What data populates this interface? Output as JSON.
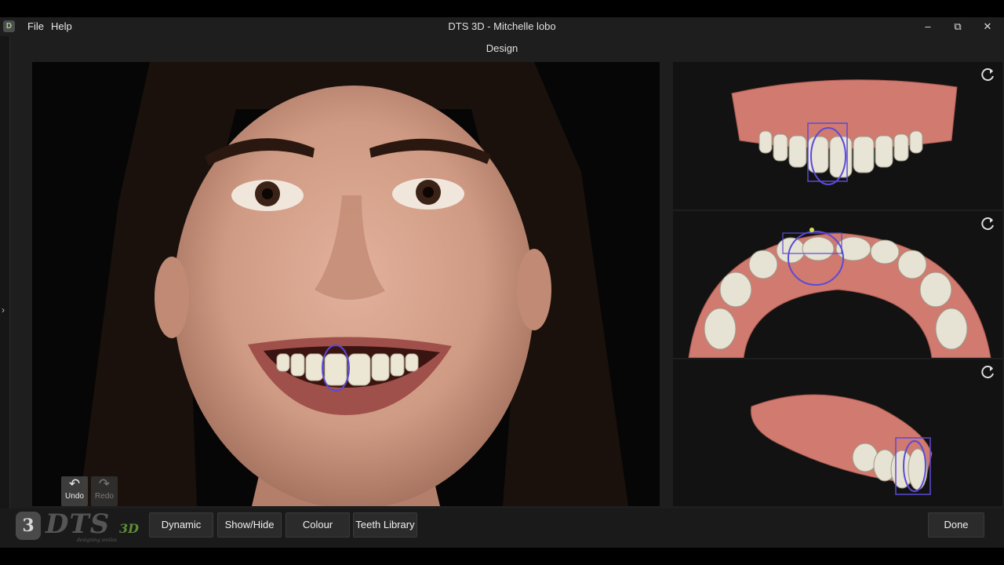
{
  "window": {
    "title": "DTS 3D - Mitchelle lobo",
    "menu": {
      "file": "File",
      "help": "Help"
    },
    "controls": {
      "minimize": "–",
      "maximize": "⧉",
      "close": "✕"
    }
  },
  "page": {
    "subtitle": "Design"
  },
  "photo_tools": {
    "undo_label": "Undo",
    "redo_label": "Redo",
    "undo_icon": "↶",
    "redo_icon": "↷"
  },
  "views": [
    {
      "name": "frontal-3d-view",
      "icon": "reset-view-icon"
    },
    {
      "name": "occlusal-3d-view",
      "icon": "reset-view-icon"
    },
    {
      "name": "lateral-3d-view",
      "icon": "reset-view-icon"
    }
  ],
  "toolbar": {
    "dynamic_label": "Dynamic",
    "showhide_label": "Show/Hide",
    "colour_label": "Colour",
    "library_label": "Teeth Library",
    "done_label": "Done"
  },
  "logo": {
    "mark": "3",
    "text": "DTS",
    "suffix": "3D",
    "tagline": "designing smiles"
  },
  "colors": {
    "background": "#1e1e1e",
    "panel": "#121212",
    "gingiva": "#d07a70",
    "tooth": "#e8e4d6",
    "guide": "#5a4bd6",
    "logo_accent": "#5e8c3a"
  }
}
